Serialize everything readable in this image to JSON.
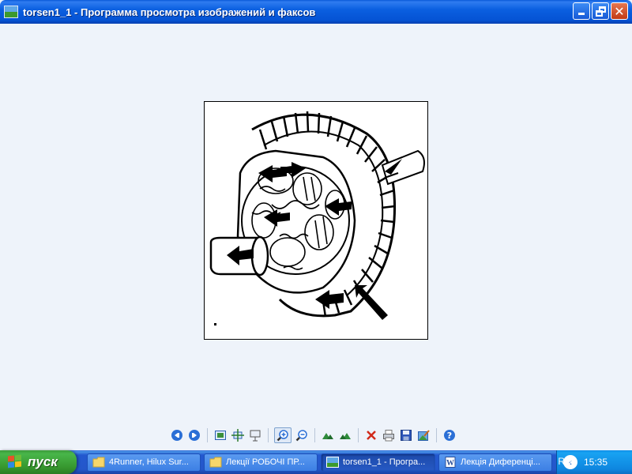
{
  "window": {
    "title": "torsen1_1 - Программа просмотра изображений и факсов",
    "icon": "image-viewer-icon"
  },
  "toolbar": {
    "buttons": [
      {
        "name": "previous-image",
        "icon": "prev-icon"
      },
      {
        "name": "next-image",
        "icon": "next-icon"
      },
      {
        "name": "best-fit",
        "icon": "best-fit-icon"
      },
      {
        "name": "actual-size",
        "icon": "actual-size-icon"
      },
      {
        "name": "slideshow",
        "icon": "slideshow-icon"
      },
      {
        "name": "zoom-in",
        "icon": "zoom-in-icon"
      },
      {
        "name": "zoom-out",
        "icon": "zoom-out-icon"
      },
      {
        "name": "rotate-clockwise",
        "icon": "rotate-cw-icon"
      },
      {
        "name": "rotate-counterclockwise",
        "icon": "rotate-ccw-icon"
      },
      {
        "name": "delete",
        "icon": "delete-icon"
      },
      {
        "name": "print",
        "icon": "print-icon"
      },
      {
        "name": "save",
        "icon": "save-icon"
      },
      {
        "name": "edit",
        "icon": "edit-icon"
      },
      {
        "name": "help",
        "icon": "help-icon"
      }
    ]
  },
  "taskbar": {
    "start_label": "пуск",
    "tasks": [
      {
        "label": "4Runner, Hilux Sur...",
        "icon": "folder-icon"
      },
      {
        "label": "Лекції РОБОЧІ ПР...",
        "icon": "folder-icon"
      },
      {
        "label": "torsen1_1 - Програ...",
        "icon": "image-viewer-icon",
        "active": true
      },
      {
        "label": "Лекція Диференці...",
        "icon": "word-document-icon"
      }
    ],
    "language": "RU",
    "clock": "15:35"
  },
  "colors": {
    "titlebar": "#0553d4",
    "viewer_background": "#eef3fa",
    "taskbar": "#2457ca",
    "start_button": "#3a9a35"
  }
}
